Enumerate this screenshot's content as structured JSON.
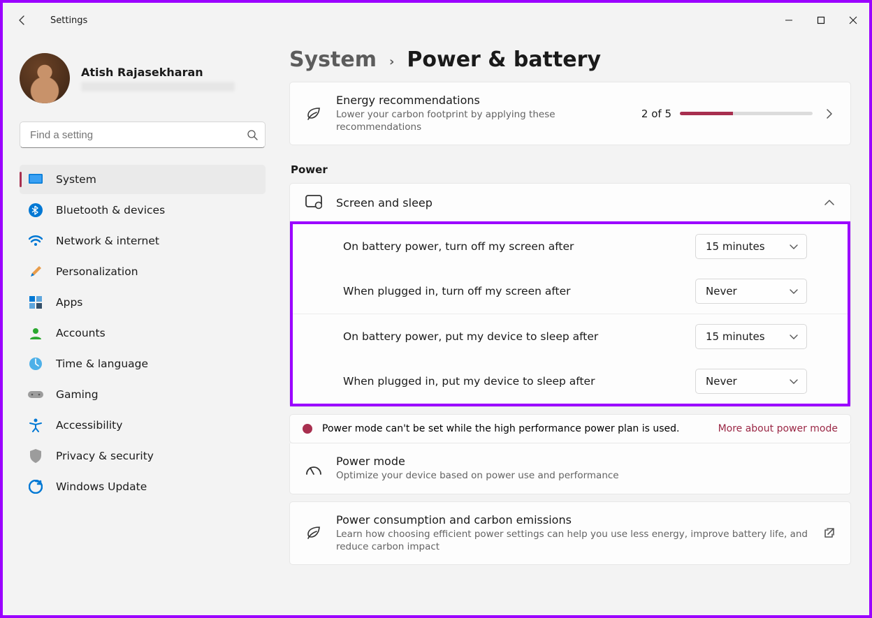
{
  "window": {
    "title": "Settings"
  },
  "user": {
    "name": "Atish Rajasekharan"
  },
  "search": {
    "placeholder": "Find a setting"
  },
  "sidebar": {
    "items": [
      {
        "label": "System"
      },
      {
        "label": "Bluetooth & devices"
      },
      {
        "label": "Network & internet"
      },
      {
        "label": "Personalization"
      },
      {
        "label": "Apps"
      },
      {
        "label": "Accounts"
      },
      {
        "label": "Time & language"
      },
      {
        "label": "Gaming"
      },
      {
        "label": "Accessibility"
      },
      {
        "label": "Privacy & security"
      },
      {
        "label": "Windows Update"
      }
    ]
  },
  "breadcrumb": {
    "parent": "System",
    "current": "Power & battery"
  },
  "energy": {
    "title": "Energy recommendations",
    "subtitle": "Lower your carbon footprint by applying these recommendations",
    "progress_label": "2 of 5",
    "progress_pct": 40
  },
  "sections": {
    "power": "Power"
  },
  "screen_sleep": {
    "title": "Screen and sleep",
    "battery_screen_label": "On battery power, turn off my screen after",
    "battery_screen_value": "15 minutes",
    "plugged_screen_label": "When plugged in, turn off my screen after",
    "plugged_screen_value": "Never",
    "battery_sleep_label": "On battery power, put my device to sleep after",
    "battery_sleep_value": "15 minutes",
    "plugged_sleep_label": "When plugged in, put my device to sleep after",
    "plugged_sleep_value": "Never"
  },
  "power_mode_banner": {
    "text": "Power mode can't be set while the high performance power plan is used.",
    "link": "More about power mode"
  },
  "power_mode": {
    "title": "Power mode",
    "subtitle": "Optimize your device based on power use and performance"
  },
  "carbon": {
    "title": "Power consumption and carbon emissions",
    "subtitle": "Learn how choosing efficient power settings can help you use less energy, improve battery life, and reduce carbon impact"
  }
}
